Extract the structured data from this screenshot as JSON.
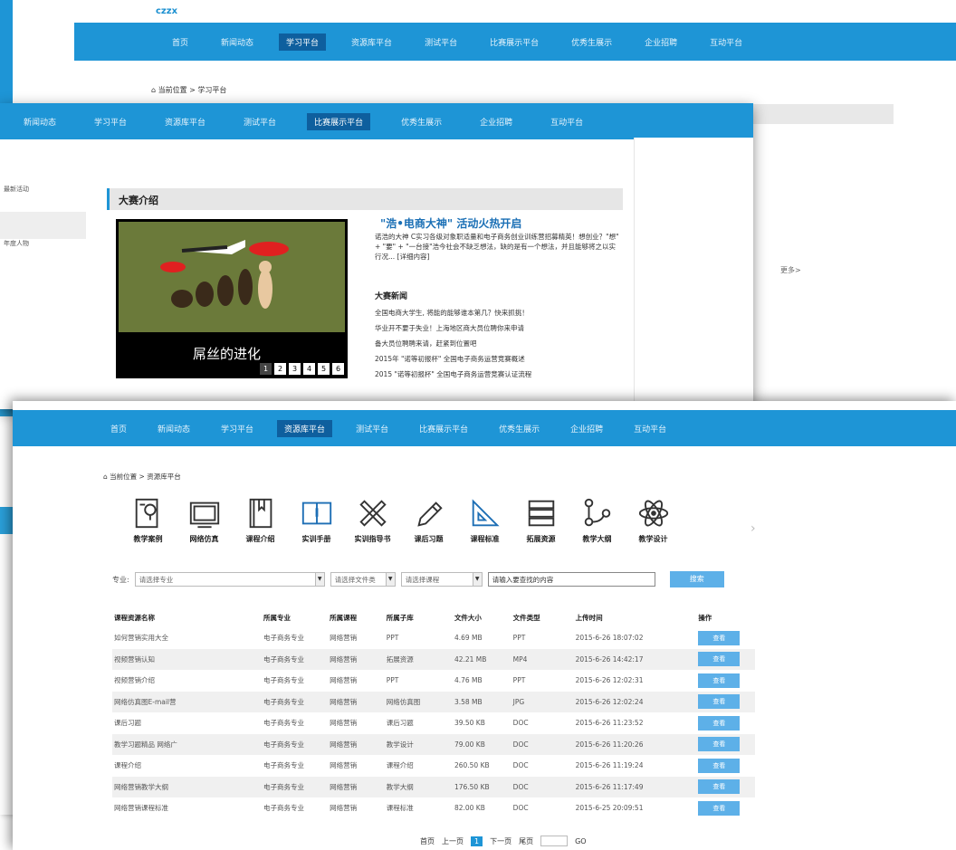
{
  "back_window": {
    "logo": "czzx",
    "nav": [
      "首页",
      "新闻动态",
      "学习平台",
      "资源库平台",
      "测试平台",
      "比赛展示平台",
      "优秀生展示",
      "企业招聘",
      "互动平台"
    ],
    "active_index": 2,
    "breadcrumb": "当前位置 > 学习平台",
    "more": "更多>"
  },
  "middle_window": {
    "nav": [
      "新闻动态",
      "学习平台",
      "资源库平台",
      "测试平台",
      "比赛展示平台",
      "优秀生展示",
      "企业招聘",
      "互动平台"
    ],
    "active_index": 4,
    "side": [
      "最新活动",
      "",
      "年度人物"
    ],
    "section_title": "大赛介绍",
    "slide_caption": "屌丝的进化",
    "slide_pages": [
      "1",
      "2",
      "3",
      "4",
      "5",
      "6"
    ],
    "headline": "\"浩•电商大神\" 活动火热开启",
    "intro": "诺浩的大神 C实习各级对象职适量和电子商务创业训练营招募精英！想创业？\"想\" + \"要\" + \"一台接\"浩今社会不缺乏想法，缺的是有一个想法，并且能够将之以实行况... [详细内容]",
    "news_title": "大赛新闻",
    "news": [
      "全国电商大学生, 将能的能够谁本第几？快来抓挑！",
      "华业开不要于失业！上海地区商大员位聘你来申请",
      "备大员位聘聘来请，赶紧到位置吧",
      "2015年 \"诺等初报杯\" 全国电子商务运营竞赛概述",
      "2015 \"诺等初报杯\" 全国电子商务运营竞赛认证流程"
    ]
  },
  "front_window": {
    "nav": [
      "首页",
      "新闻动态",
      "学习平台",
      "资源库平台",
      "测试平台",
      "比赛展示平台",
      "优秀生展示",
      "企业招聘",
      "互动平台"
    ],
    "active_index": 3,
    "breadcrumb": "当前位置 > 资源库平台",
    "categories": [
      {
        "label": "教学案例",
        "icon": "lightbulb-doc-icon"
      },
      {
        "label": "网络仿真",
        "icon": "monitor-icon"
      },
      {
        "label": "课程介绍",
        "icon": "book-icon"
      },
      {
        "label": "实训手册",
        "icon": "manual-icon"
      },
      {
        "label": "实训指导书",
        "icon": "ruler-pencil-icon"
      },
      {
        "label": "课后习题",
        "icon": "pencil-icon"
      },
      {
        "label": "课程标准",
        "icon": "triangle-ruler-icon"
      },
      {
        "label": "拓展资源",
        "icon": "stack-icon"
      },
      {
        "label": "教学大纲",
        "icon": "nodes-icon"
      },
      {
        "label": "教学设计",
        "icon": "atom-icon"
      }
    ],
    "filters": {
      "major_label": "专业:",
      "major_value": "请选择专业",
      "filetype_value": "请选择文件类",
      "course_value": "请选择课程",
      "search_placeholder": "请输入要查找的内容",
      "search_button": "搜索"
    },
    "table": {
      "headers": [
        "课程资源名称",
        "所属专业",
        "所属课程",
        "所属子库",
        "文件大小",
        "文件类型",
        "上传时间",
        "操作"
      ],
      "rows": [
        [
          "如何营销实用大全",
          "电子商务专业",
          "网络营销",
          "PPT",
          "4.69 MB",
          "PPT",
          "2015-6-26 18:07:02",
          "查看"
        ],
        [
          "视频营销认知",
          "电子商务专业",
          "网络营销",
          "拓展资源",
          "42.21 MB",
          "MP4",
          "2015-6-26 14:42:17",
          "查看"
        ],
        [
          "视频营销介绍",
          "电子商务专业",
          "网络营销",
          "PPT",
          "4.76 MB",
          "PPT",
          "2015-6-26 12:02:31",
          "查看"
        ],
        [
          "网络仿真图E-mail营",
          "电子商务专业",
          "网络营销",
          "网络仿真图",
          "3.58 MB",
          "JPG",
          "2015-6-26 12:02:24",
          "查看"
        ],
        [
          "课后习题",
          "电子商务专业",
          "网络营销",
          "课后习题",
          "39.50 KB",
          "DOC",
          "2015-6-26 11:23:52",
          "查看"
        ],
        [
          "教学习题精品 网络广",
          "电子商务专业",
          "网络营销",
          "教学设计",
          "79.00 KB",
          "DOC",
          "2015-6-26 11:20:26",
          "查看"
        ],
        [
          "课程介绍",
          "电子商务专业",
          "网络营销",
          "课程介绍",
          "260.50 KB",
          "DOC",
          "2015-6-26 11:19:24",
          "查看"
        ],
        [
          "网络营销教学大纲",
          "电子商务专业",
          "网络营销",
          "教学大纲",
          "176.50 KB",
          "DOC",
          "2015-6-26 11:17:49",
          "查看"
        ],
        [
          "网络营销课程标准",
          "电子商务专业",
          "网络营销",
          "课程标准",
          "82.00 KB",
          "DOC",
          "2015-6-25 20:09:51",
          "查看"
        ]
      ]
    },
    "pager": {
      "first": "首页",
      "prev": "上一页",
      "current": "1",
      "next": "下一页",
      "last": "尾页",
      "go": "GO"
    }
  }
}
